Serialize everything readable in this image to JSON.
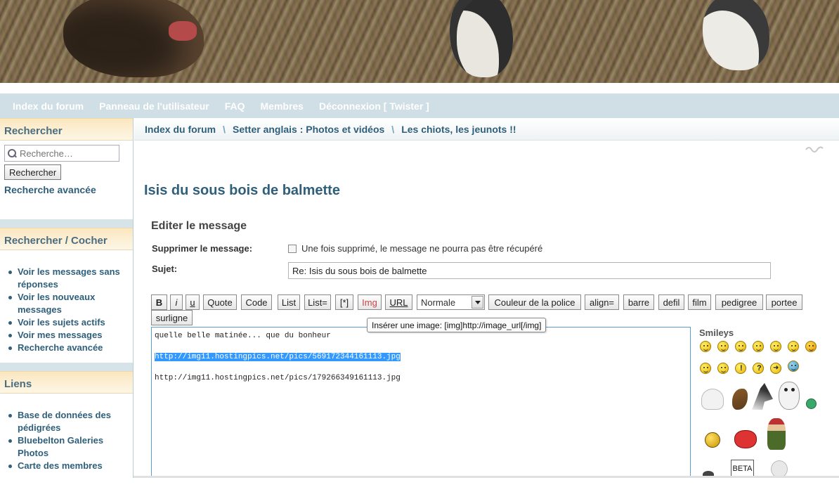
{
  "nav": {
    "items": [
      "Index du forum",
      "Panneau de l'utilisateur",
      "FAQ",
      "Membres",
      "Déconnexion [ Twister ]"
    ]
  },
  "sidebar": {
    "search_title": "Rechercher",
    "search_placeholder": "Recherche…",
    "search_button": "Rechercher",
    "advanced_link": "Recherche avancée",
    "check_title": "Rechercher / Cocher",
    "check_items": [
      "Voir les messages sans réponses",
      "Voir les nouveaux messages",
      "Voir les sujets actifs",
      "Voir mes messages",
      "Recherche avancée"
    ],
    "links_title": "Liens",
    "links_items": [
      "Base de données des pédigrées",
      "Bluebelton Galeries Photos",
      "Carte des membres"
    ]
  },
  "breadcrumb": [
    "Index du forum",
    "Setter anglais : Photos et vidéos",
    "Les chiots, les jeunots !!"
  ],
  "breadcrumb_sep": "\\",
  "topic_title": "Isis du sous bois de balmette",
  "form": {
    "heading": "Editer le message",
    "delete_label": "Supprimer le message:",
    "delete_text": "Une fois supprimé, le message ne pourra pas être récupéré",
    "subject_label": "Sujet:",
    "subject_value": "Re: Isis du sous bois de balmette"
  },
  "toolbar": {
    "bold": "B",
    "italic": "i",
    "underline": "u",
    "quote": "Quote",
    "code": "Code",
    "list": "List",
    "list_eq": "List=",
    "star": "[*]",
    "img": "Img",
    "url": "URL",
    "size_selected": "Normale",
    "color": "Couleur de la police",
    "align": "align=",
    "barre": "barre",
    "defil": "defil",
    "film": "film",
    "pedigree": "pedigree",
    "portee": "portee",
    "surligne": "surligne"
  },
  "tooltip": "Insérer une image: [img]http://image_url[/img]",
  "editor": {
    "line1": "quelle belle matinée... que du bonheur",
    "line2": "http://img11.hostingpics.net/pics/569172344161113.jpg",
    "line3": "http://img11.hostingpics.net/pics/179266349161113.jpg"
  },
  "smileys": {
    "title": "Smileys",
    "beta_label": "BETA"
  },
  "colors": {
    "link_blue": "#2f5f7a",
    "nav_bg": "#cfdfe5",
    "selection": "#3399ff",
    "img_button_text": "#cc4444"
  }
}
